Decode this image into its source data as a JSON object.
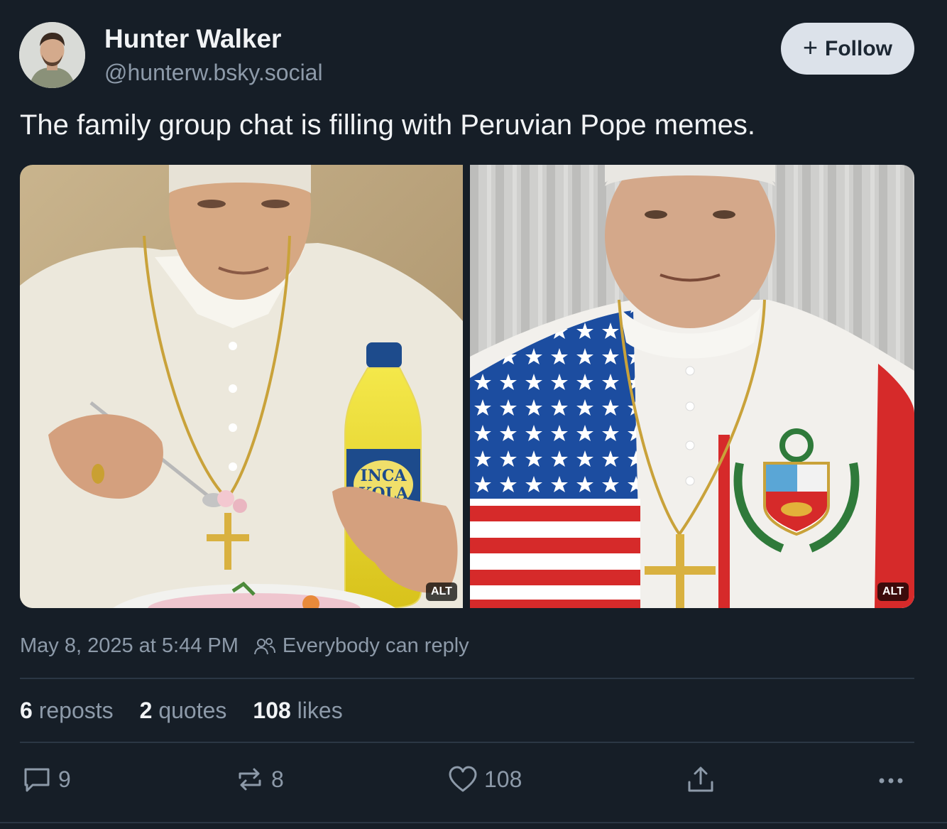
{
  "author": {
    "name": "Hunter Walker",
    "handle": "@hunterw.bsky.social",
    "avatar_icon": "user-avatar"
  },
  "follow_button": {
    "label": "Follow",
    "icon": "plus-icon"
  },
  "post": {
    "text": "The family group chat is filling with Peruvian Pope memes.",
    "images": [
      {
        "bottle_label_line1": "INCA",
        "bottle_label_line2": "KOLA",
        "alt_badge": "ALT"
      },
      {
        "alt_badge": "ALT"
      }
    ],
    "timestamp": "May 8, 2025 at 5:44 PM",
    "reply_setting": "Everybody can reply"
  },
  "stats": {
    "reposts_count": "6",
    "reposts_label": "reposts",
    "quotes_count": "2",
    "quotes_label": "quotes",
    "likes_count": "108",
    "likes_label": "likes"
  },
  "actions": {
    "reply_count": "9",
    "repost_count": "8",
    "like_count": "108"
  },
  "colors": {
    "background": "#161e27",
    "text_primary": "#f1f3f5",
    "text_secondary": "#8d9aa9",
    "follow_bg": "#dce2ea",
    "divider": "#2b3744"
  }
}
